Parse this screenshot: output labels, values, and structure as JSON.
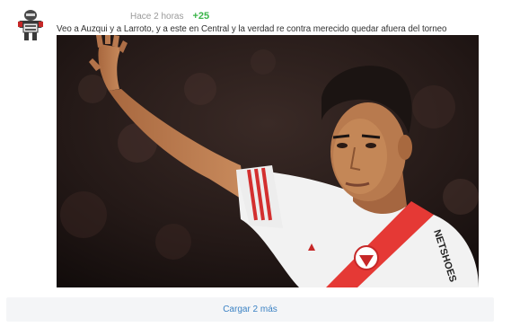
{
  "comment": {
    "avatar_icon": "user-avatar-icon",
    "timestamp": "Hace 2 horas",
    "score": "+25",
    "text": "Veo a Auzqui y a Larroto, y a este en Central y la verdad re contra merecido quedar afuera del torneo",
    "image": {
      "alt": "Jugador de fútbol con camiseta blanca y banda roja levantando la mano",
      "jersey_text": "NETSHOES"
    }
  },
  "load_more": {
    "label": "Cargar 2 más"
  },
  "colors": {
    "score_green": "#3bb54a",
    "link_blue": "#3b82c4",
    "muted_gray": "#9a9a9a",
    "bar_bg": "#f4f5f7"
  }
}
